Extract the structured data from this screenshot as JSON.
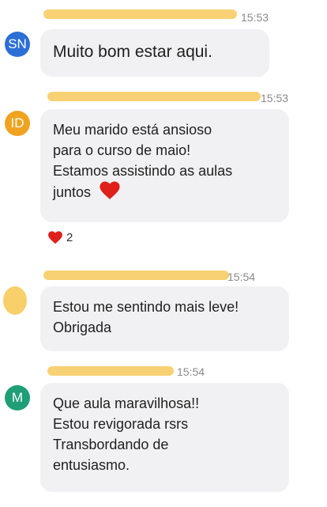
{
  "messages": [
    {
      "avatar_initials": "SN",
      "avatar_color": "#2b6fd6",
      "time": "15:53",
      "lines": [
        "Muito bom estar aqui."
      ]
    },
    {
      "avatar_initials": "ID",
      "avatar_color": "#f0a321",
      "time": "15:53",
      "lines": [
        "Meu marido está ansioso",
        "para o curso de maio!",
        "Estamos assistindo as aulas",
        "juntos"
      ],
      "inline_icon": "heart-icon",
      "reaction": {
        "icon": "heart-icon",
        "count": "2"
      }
    },
    {
      "avatar_initials": "",
      "avatar_color": "#f7cf6b",
      "time": "15:54",
      "lines": [
        "Estou me sentindo mais leve!",
        "Obrigada"
      ]
    },
    {
      "avatar_initials": "M",
      "avatar_color": "#1f9e78",
      "time": "15:54",
      "lines": [
        "Que aula maravilhosa!!",
        "Estou revigorada rsrs",
        "Transbordando de",
        "entusiasmo."
      ]
    }
  ],
  "colors": {
    "bubble": "#f1f1f3",
    "redacted_name": "#f7cf6b",
    "heart": "#e0201b"
  }
}
